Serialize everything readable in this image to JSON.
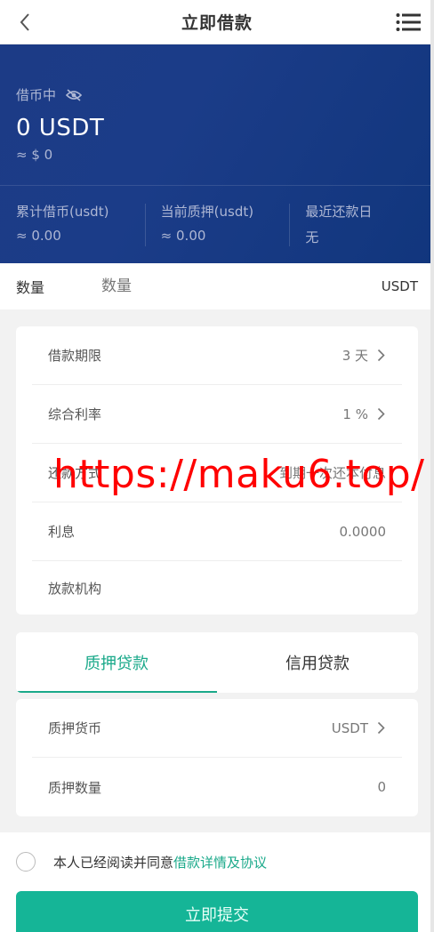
{
  "header": {
    "title": "立即借款",
    "back_icon": "chevron-left-icon",
    "menu_icon": "menu-icon"
  },
  "hero": {
    "label": "借币中",
    "amount": "0 USDT",
    "approx": "≈ $ 0",
    "stats": [
      {
        "title": "累计借币(usdt)",
        "value": "≈ 0.00"
      },
      {
        "title": "当前质押(usdt)",
        "value": "≈ 0.00"
      },
      {
        "title": "最近还款日",
        "value": "无"
      }
    ]
  },
  "quantity": {
    "label": "数量",
    "placeholder": "数量",
    "unit": "USDT"
  },
  "loan_details": [
    {
      "label": "借款期限",
      "value": "3 天",
      "arrow": true
    },
    {
      "label": "综合利率",
      "value": "1 %",
      "arrow": true
    },
    {
      "label": "还款方式",
      "value": "到期一次还本付息",
      "arrow": false
    },
    {
      "label": "利息",
      "value": "0.0000",
      "arrow": false
    },
    {
      "label": "放款机构",
      "value": "",
      "arrow": false
    }
  ],
  "tabs": [
    {
      "label": "质押贷款",
      "active": true
    },
    {
      "label": "信用贷款",
      "active": false
    }
  ],
  "collateral": [
    {
      "label": "质押货币",
      "value": "USDT",
      "arrow": true
    },
    {
      "label": "质押数量",
      "value": "0",
      "arrow": false
    }
  ],
  "agreement": {
    "text": "本人已经阅读并同意",
    "link": "借款详情及协议"
  },
  "submit_label": "立即提交",
  "watermark": "https://maku6.top/",
  "colors": {
    "primary": "#15b597",
    "accent_text": "#1aa98a",
    "hero_bg": "#1b3c88",
    "watermark": "#ff0000"
  }
}
